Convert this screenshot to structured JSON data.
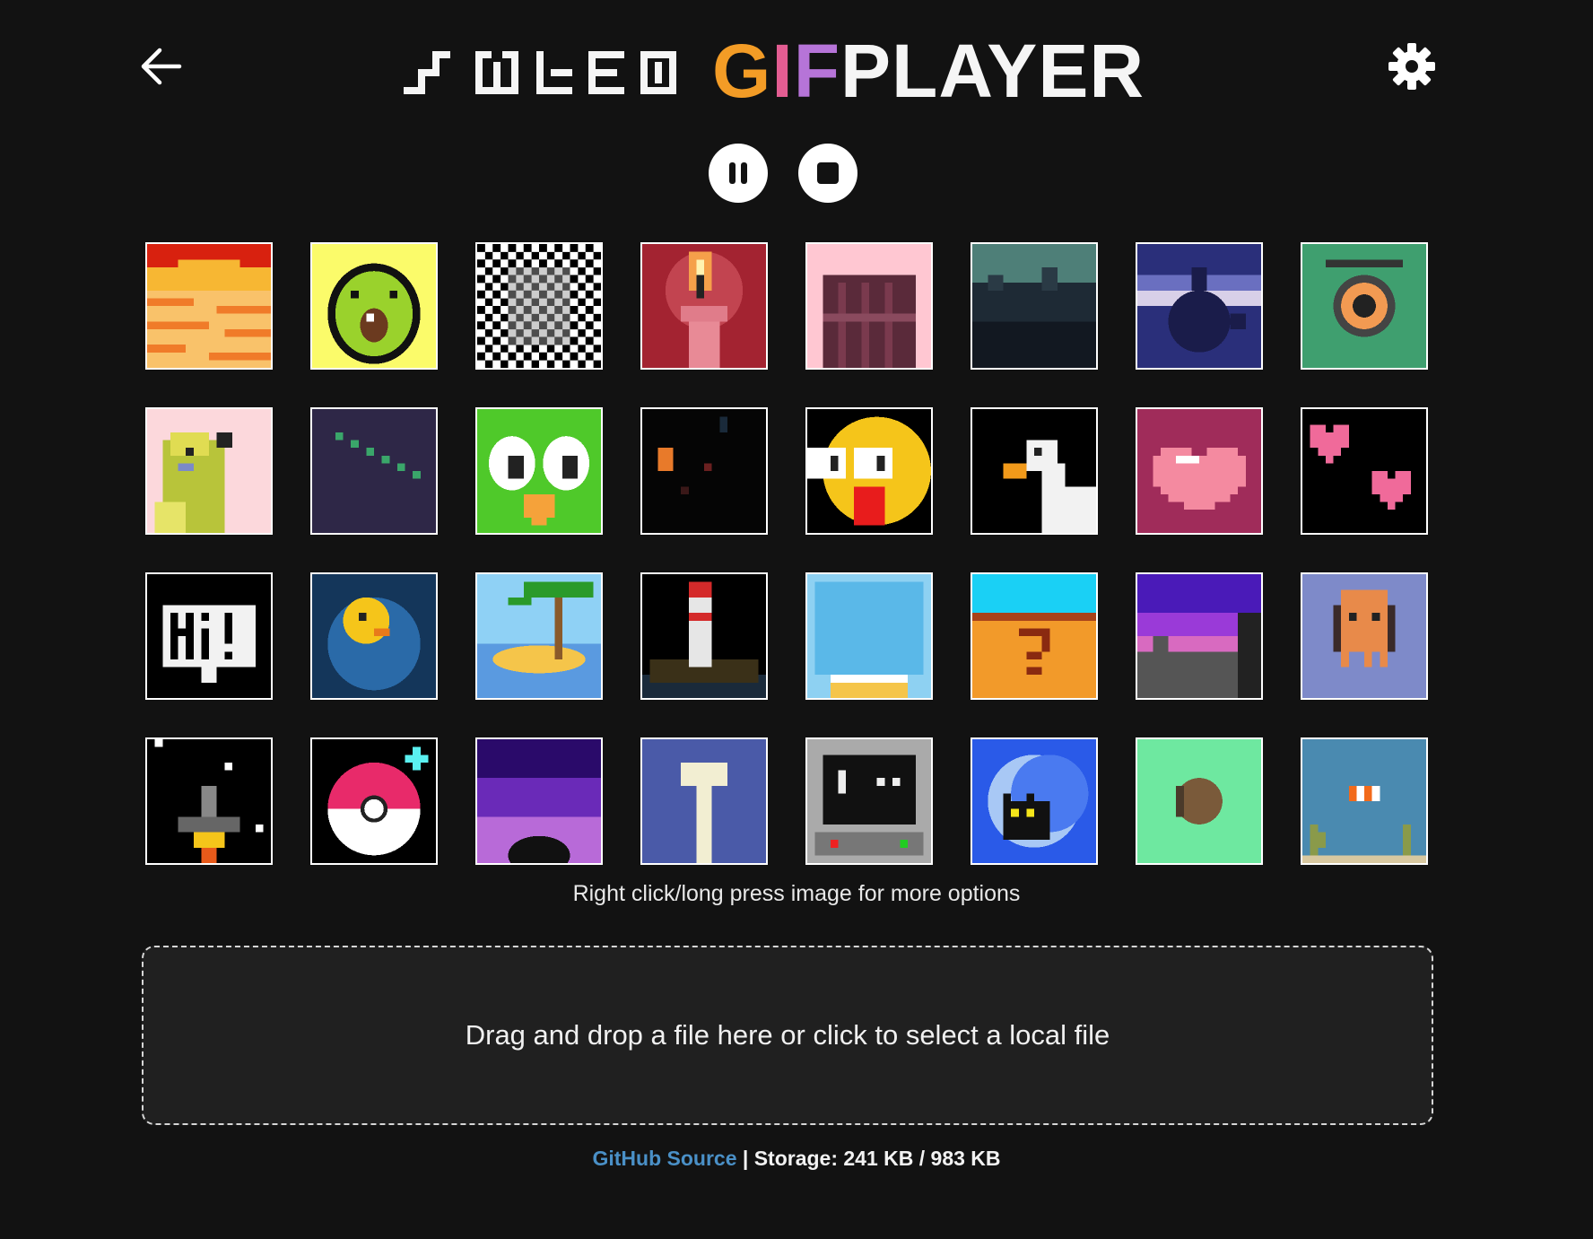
{
  "header": {
    "back_icon": "arrow-left-icon",
    "title_wled": "WLED",
    "title_gif_letters": [
      "G",
      "I",
      "F"
    ],
    "title_player": "PLAYER",
    "settings_icon": "gear-icon"
  },
  "controls": {
    "pause_icon": "pause-icon",
    "stop_icon": "stop-icon"
  },
  "gallery": {
    "tiles": [
      "sunset",
      "avocado",
      "checker-tunnel",
      "candle",
      "window",
      "forest",
      "teapot",
      "eye-monster",
      "parrot",
      "falling-dots",
      "owl",
      "dark-particles",
      "surprised-face",
      "goose",
      "heart",
      "floating-hearts",
      "hi-bubble",
      "duck-in-water",
      "palm-island",
      "lighthouse",
      "blue-window",
      "question-block",
      "city-night",
      "octopus",
      "rocket",
      "pokeball",
      "purple-sunset",
      "pillar",
      "retro-computer",
      "moon-cat",
      "potato",
      "clownfish-aquarium"
    ],
    "hint": "Right click/long press image for more options"
  },
  "dropzone": {
    "label": "Drag and drop a file here or click to select a local file"
  },
  "footer": {
    "link_label": "GitHub Source",
    "separator": "|",
    "storage_text": "Storage: 241 KB / 983 KB"
  },
  "colors": {
    "background": "#121212",
    "dropzone_bg": "#202020",
    "link": "#4a90c7",
    "gif_g": "#f39c26",
    "gif_i": "#e35d92",
    "gif_f": "#b674d8"
  }
}
